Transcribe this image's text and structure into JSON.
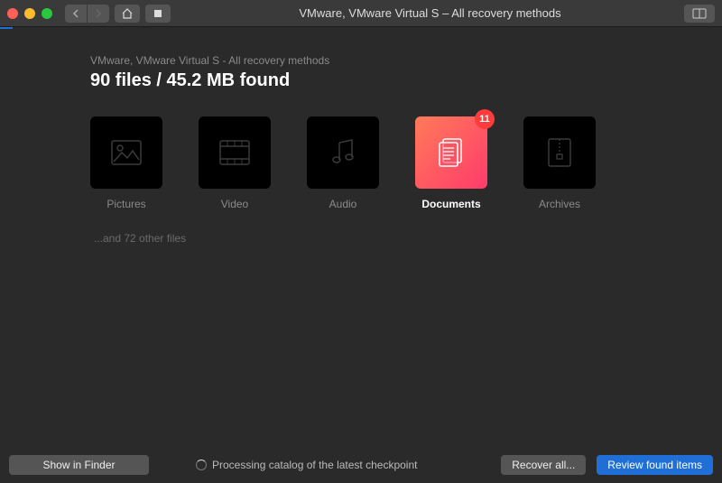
{
  "window_title": "VMware, VMware Virtual S – All recovery methods",
  "breadcrumb": "VMware, VMware Virtual S - All recovery methods",
  "headline": "90 files / 45.2 MB found",
  "categories": [
    {
      "label": "Pictures",
      "icon": "image-icon",
      "selected": false,
      "badge": null
    },
    {
      "label": "Video",
      "icon": "video-icon",
      "selected": false,
      "badge": null
    },
    {
      "label": "Audio",
      "icon": "audio-icon",
      "selected": false,
      "badge": null
    },
    {
      "label": "Documents",
      "icon": "document-icon",
      "selected": true,
      "badge": "11"
    },
    {
      "label": "Archives",
      "icon": "archive-icon",
      "selected": false,
      "badge": null
    }
  ],
  "other_files_text": "...and 72 other files",
  "status_text": "Processing catalog of the latest checkpoint",
  "buttons": {
    "show_in_finder": "Show in Finder",
    "recover_all": "Recover all...",
    "review_found": "Review found items"
  }
}
